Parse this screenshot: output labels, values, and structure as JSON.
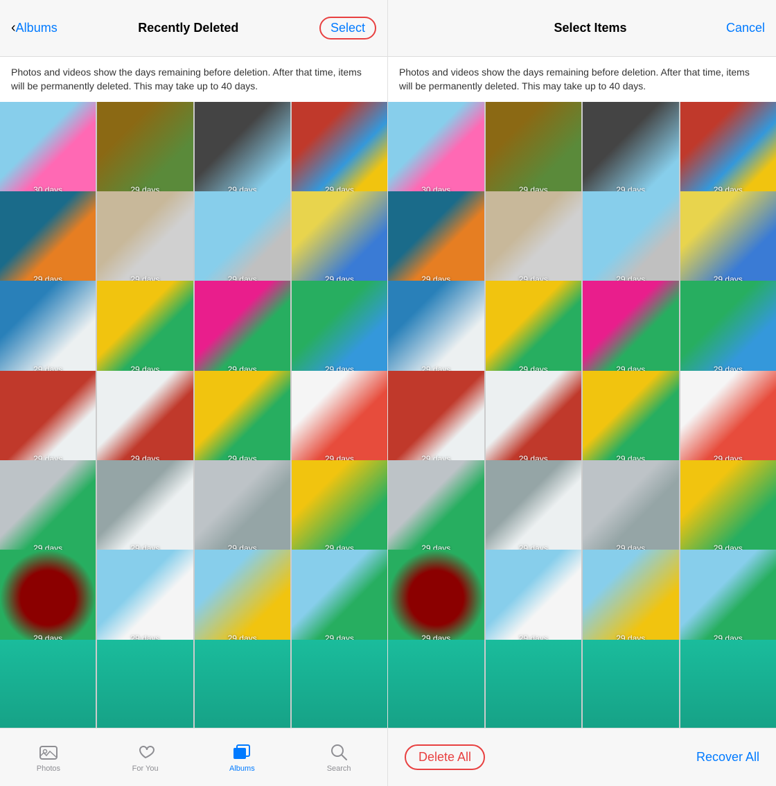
{
  "left_screen": {
    "header": {
      "back_label": "Albums",
      "title": "Recently Deleted",
      "action_label": "Select"
    },
    "info_text": "Photos and videos show the days remaining before deletion. After that time, items will be permanently deleted. This may take up to 40 days.",
    "photos": [
      {
        "days": "30 days",
        "class": "p1"
      },
      {
        "days": "29 days",
        "class": "p2"
      },
      {
        "days": "29 days",
        "class": "p3"
      },
      {
        "days": "29 days",
        "class": "p4"
      },
      {
        "days": "29 days",
        "class": "p5"
      },
      {
        "days": "29 days",
        "class": "p6"
      },
      {
        "days": "29 days",
        "class": "p7"
      },
      {
        "days": "29 days",
        "class": "p8"
      },
      {
        "days": "29 days",
        "class": "p13"
      },
      {
        "days": "29 days",
        "class": "p14"
      },
      {
        "days": "29 days",
        "class": "p15"
      },
      {
        "days": "29 days",
        "class": "p16"
      },
      {
        "days": "29 days",
        "class": "p17"
      },
      {
        "days": "29 days",
        "class": "p18"
      },
      {
        "days": "29 days",
        "class": "p19"
      },
      {
        "days": "29 days",
        "class": "p20"
      },
      {
        "days": "29 days",
        "class": "p21"
      },
      {
        "days": "29 days",
        "class": "p22"
      },
      {
        "days": "29 days",
        "class": "p23"
      },
      {
        "days": "29 days",
        "class": "p24"
      },
      {
        "days": "29 days",
        "class": "salad"
      },
      {
        "days": "29 days",
        "class": "p26"
      },
      {
        "days": "29 days",
        "class": "p27"
      },
      {
        "days": "29 days",
        "class": "p28"
      },
      {
        "days": "",
        "class": "teal-bottom"
      },
      {
        "days": "",
        "class": "teal-bottom"
      },
      {
        "days": "",
        "class": "teal-bottom"
      },
      {
        "days": "",
        "class": "teal-bottom"
      }
    ],
    "nav": {
      "items": [
        {
          "label": "Photos",
          "icon": "photos",
          "active": false
        },
        {
          "label": "For You",
          "icon": "foryou",
          "active": false
        },
        {
          "label": "Albums",
          "icon": "albums",
          "active": true
        },
        {
          "label": "Search",
          "icon": "search",
          "active": false
        }
      ]
    }
  },
  "right_screen": {
    "header": {
      "title": "Select Items",
      "cancel_label": "Cancel"
    },
    "info_text": "Photos and videos show the days remaining before deletion. After that time, items will be permanently deleted. This may take up to 40 days.",
    "photos": [
      {
        "days": "30 days",
        "class": "p1"
      },
      {
        "days": "29 days",
        "class": "p2"
      },
      {
        "days": "29 days",
        "class": "p3"
      },
      {
        "days": "29 days",
        "class": "p4"
      },
      {
        "days": "29 days",
        "class": "p5"
      },
      {
        "days": "29 days",
        "class": "p6"
      },
      {
        "days": "29 days",
        "class": "p7"
      },
      {
        "days": "29 days",
        "class": "p8"
      },
      {
        "days": "29 days",
        "class": "p13"
      },
      {
        "days": "29 days",
        "class": "p14"
      },
      {
        "days": "29 days",
        "class": "p15"
      },
      {
        "days": "29 days",
        "class": "p16"
      },
      {
        "days": "29 days",
        "class": "p17"
      },
      {
        "days": "29 days",
        "class": "p18"
      },
      {
        "days": "29 days",
        "class": "p19"
      },
      {
        "days": "29 days",
        "class": "p20"
      },
      {
        "days": "29 days",
        "class": "p21"
      },
      {
        "days": "29 days",
        "class": "p22"
      },
      {
        "days": "29 days",
        "class": "p23"
      },
      {
        "days": "29 days",
        "class": "p24"
      },
      {
        "days": "29 days",
        "class": "salad"
      },
      {
        "days": "29 days",
        "class": "p26"
      },
      {
        "days": "29 days",
        "class": "p27"
      },
      {
        "days": "29 days",
        "class": "p28"
      },
      {
        "days": "",
        "class": "teal-bottom"
      },
      {
        "days": "",
        "class": "teal-bottom"
      },
      {
        "days": "",
        "class": "teal-bottom"
      },
      {
        "days": "",
        "class": "teal-bottom"
      }
    ],
    "bottom_bar": {
      "delete_all_label": "Delete All",
      "recover_all_label": "Recover All"
    }
  }
}
